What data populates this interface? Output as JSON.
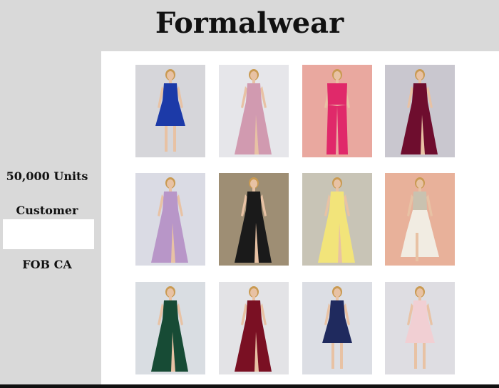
{
  "page": {
    "title": "Formalwear"
  },
  "sidebar": {
    "units": "50,000 Units",
    "cost_label": "Customer Cost:",
    "cost_value": "",
    "fob": "FOB CA"
  },
  "products": [
    {
      "id": 1,
      "icon": "dress-royal-blue-short",
      "bg": "#d6d6da",
      "color": "#1c3aa8",
      "style": "short"
    },
    {
      "id": 2,
      "icon": "dress-mauve-halter",
      "bg": "#e6e6ea",
      "color": "#d19ab0",
      "style": "long-slit"
    },
    {
      "id": 3,
      "icon": "jumpsuit-fuchsia",
      "bg": "#e9a89f",
      "color": "#e0296a",
      "style": "jumpsuit"
    },
    {
      "id": 4,
      "icon": "dress-burgundy-gown",
      "bg": "#c9c7cf",
      "color": "#6e0d2e",
      "style": "long-slit"
    },
    {
      "id": 5,
      "icon": "dress-lilac-gown",
      "bg": "#dadbe4",
      "color": "#b896c8",
      "style": "long-slit"
    },
    {
      "id": 6,
      "icon": "dress-black-sheer",
      "bg": "#9e8e74",
      "color": "#1a1a1a",
      "style": "long-slit"
    },
    {
      "id": 7,
      "icon": "dress-yellow-sheer",
      "bg": "#c8c4b6",
      "color": "#f2e47a",
      "style": "long-slit"
    },
    {
      "id": 8,
      "icon": "dress-ivory-highlow",
      "bg": "#e8b19a",
      "color": "#f1ece2",
      "style": "high-low"
    },
    {
      "id": 9,
      "icon": "dress-emerald-gown",
      "bg": "#d9dde2",
      "color": "#174b35",
      "style": "long-slit"
    },
    {
      "id": 10,
      "icon": "dress-wine-lace-gown",
      "bg": "#e3e3e6",
      "color": "#7a1023",
      "style": "long-slit"
    },
    {
      "id": 11,
      "icon": "dress-navy-short",
      "bg": "#dcdee4",
      "color": "#1f2a5e",
      "style": "short"
    },
    {
      "id": 12,
      "icon": "dress-blush-short",
      "bg": "#dedde2",
      "color": "#f1cfd3",
      "style": "short"
    }
  ]
}
